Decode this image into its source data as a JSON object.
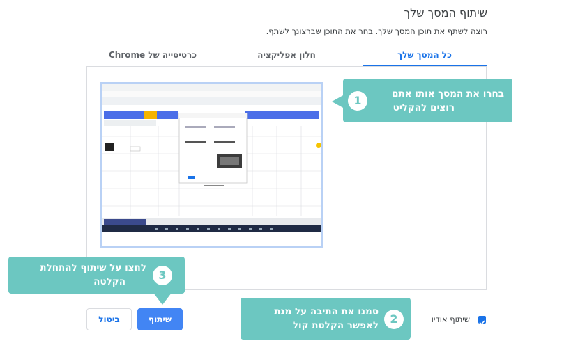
{
  "dialog": {
    "title": "שיתוף המסך שלך",
    "subtitle": "רוצה לשתף את תוכן המסך שלך. בחר את התוכן שברצונך לשתף."
  },
  "tabs": [
    {
      "label": "כל המסך שלך",
      "active": true
    },
    {
      "label": "חלון אפליקציה",
      "active": false
    },
    {
      "label": "כרטיסייה של Chrome",
      "active": false
    }
  ],
  "audio": {
    "label": "שיתוף אודיו",
    "checked": true
  },
  "buttons": {
    "share": "שיתוף",
    "cancel": "ביטול"
  },
  "callouts": [
    {
      "num": "1",
      "line1": "בחרו את המסך אותו אתם",
      "line2": "רוצים להקליט"
    },
    {
      "num": "2",
      "line1": "סמנו את התיבה על מנת",
      "line2": "לאפשר הקלטת קול"
    },
    {
      "num": "3",
      "line1": "לחצו על שיתוף להתחלת",
      "line2": "הקלטה"
    }
  ],
  "colors": {
    "accent": "#1a73e8",
    "callout": "#6cc7c1",
    "selection": "#b9d1f5"
  }
}
